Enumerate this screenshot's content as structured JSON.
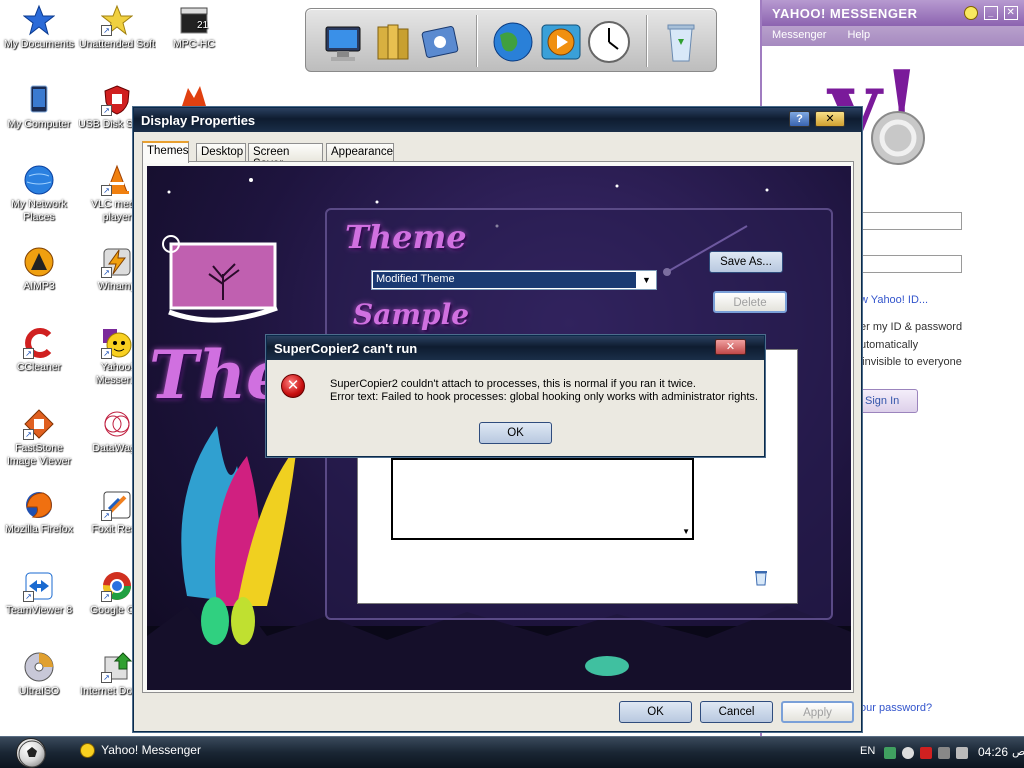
{
  "desktop": {
    "icons": [
      {
        "label": "My Documents"
      },
      {
        "label": "Unattended Soft"
      },
      {
        "label": "MPC-HC"
      },
      {
        "label": "My Computer"
      },
      {
        "label": "USB Disk Securi"
      },
      {
        "label": "My Network Places"
      },
      {
        "label": "VLC media player"
      },
      {
        "label": "AIMP3"
      },
      {
        "label": "Winamp"
      },
      {
        "label": "CCleaner"
      },
      {
        "label": "Yahoo! Messeng"
      },
      {
        "label": "FastStone Image Viewer"
      },
      {
        "label": "DataWago"
      },
      {
        "label": "Mozilla Firefox"
      },
      {
        "label": "Foxit Read"
      },
      {
        "label": "TeamViewer 8"
      },
      {
        "label": "Google Chr"
      },
      {
        "label": "UltraISO"
      },
      {
        "label": "Internet Downlo"
      }
    ]
  },
  "dock": {
    "items": [
      "computer-icon",
      "folder-icon",
      "control-panel-icon",
      "globe-icon",
      "media-player-icon",
      "clock-icon",
      "recycle-bin-icon"
    ]
  },
  "yahoo": {
    "title": "YAHOO! MESSENGER",
    "menu": [
      "Messenger",
      "Help"
    ],
    "new_id_link": "w Yahoo! ID...",
    "remember": "er my ID & password",
    "auto": "utomatically",
    "invisible": "n invisible to everyone",
    "sign_in": "Sign In",
    "forgot": "our password?"
  },
  "display_props": {
    "title": "Display Properties",
    "tabs": [
      "Themes",
      "Desktop",
      "Screen Saver",
      "Appearance"
    ],
    "theme_heading": "Theme",
    "sample_heading": "Sample",
    "big_art_text": "Them",
    "theme_selected": "Modified Theme",
    "save_as": "Save As...",
    "delete": "Delete",
    "ok": "OK",
    "cancel": "Cancel",
    "apply": "Apply"
  },
  "dialog": {
    "title": "SuperCopier2 can't run",
    "line1": "SuperCopier2 couldn't attach to processes, this is normal if you ran it twice.",
    "line2": "Error text: Failed to hook processes: global hooking only works with administrator rights.",
    "ok": "OK"
  },
  "taskbar": {
    "task": "Yahoo! Messenger",
    "lang": "EN",
    "time": "04:26",
    "ampm": "ص"
  }
}
